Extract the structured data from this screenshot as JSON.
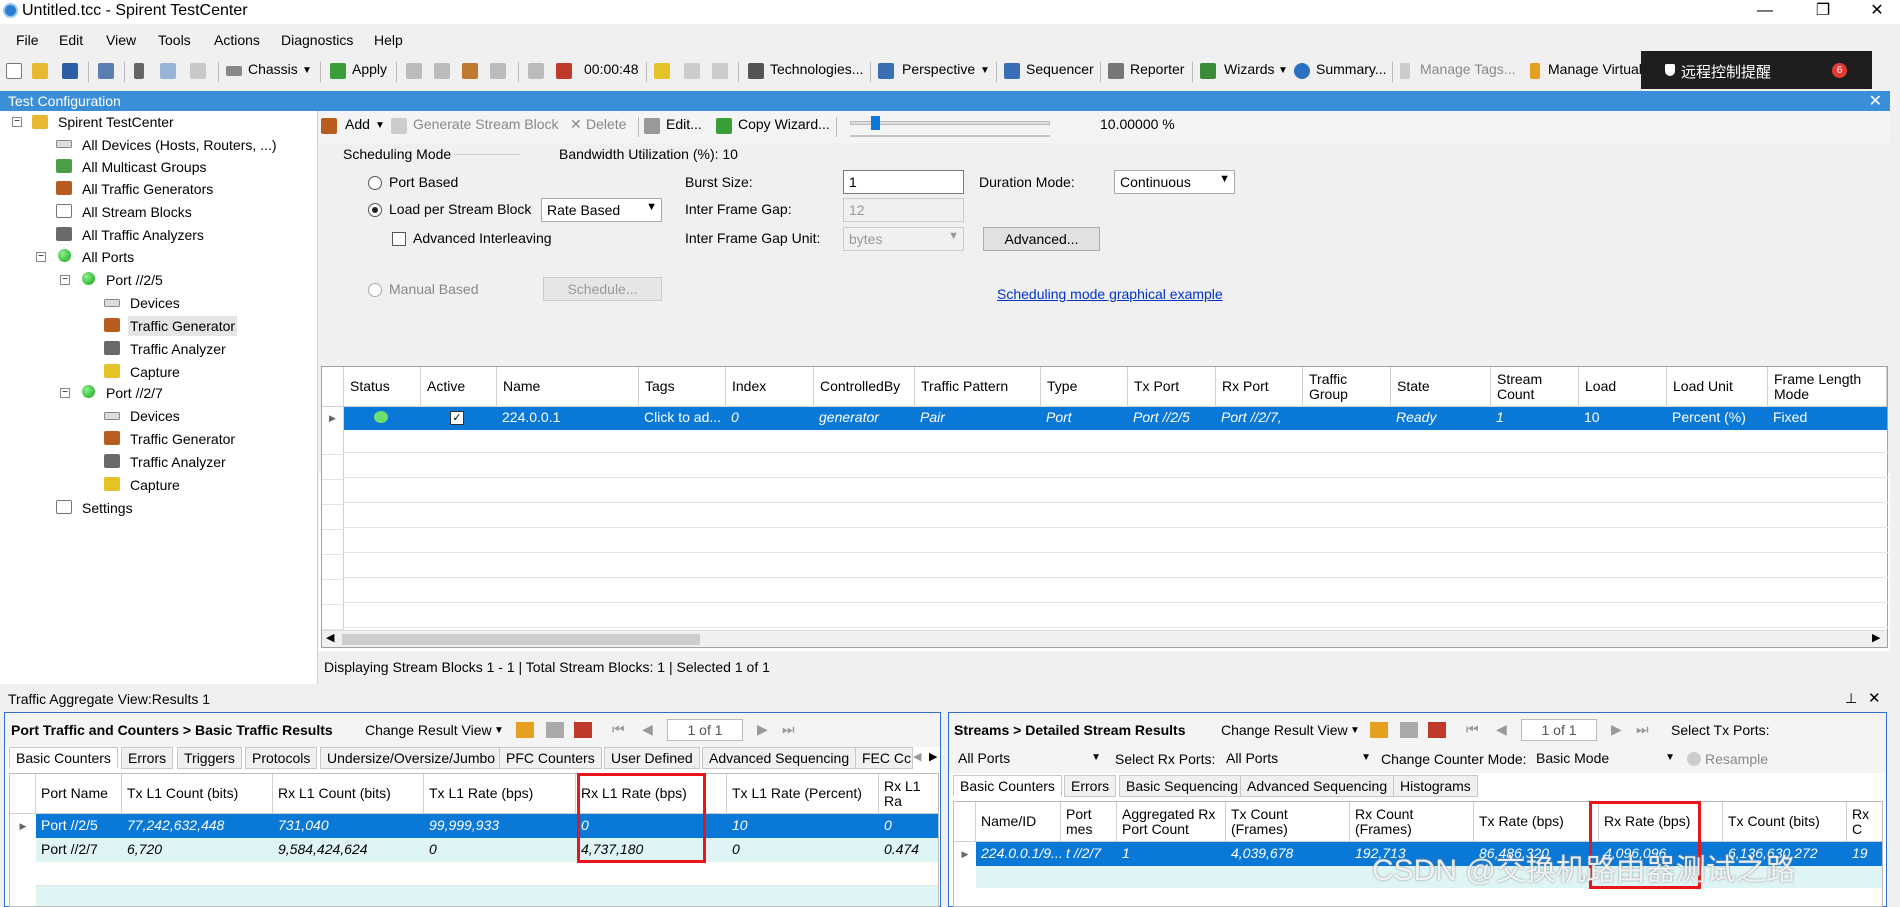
{
  "window": {
    "title": "Untitled.tcc - Spirent TestCenter",
    "min": "—",
    "max": "❐",
    "close": "✕"
  },
  "menu": [
    "File",
    "Edit",
    "View",
    "Tools",
    "Actions",
    "Diagnostics",
    "Help"
  ],
  "toolbar": {
    "chassis": "Chassis",
    "apply": "Apply",
    "timer": "00:00:48",
    "technologies": "Technologies...",
    "perspective": "Perspective",
    "sequencer": "Sequencer",
    "reporter": "Reporter",
    "wizards": "Wizards",
    "summary": "Summary...",
    "manage_tags": "Manage Tags...",
    "manage_virtual": "Manage Virtual"
  },
  "notification": {
    "text": "远程控制提醒",
    "count": "6"
  },
  "panel": {
    "title": "Test Configuration"
  },
  "tree": {
    "root": "Spirent TestCenter",
    "items": [
      "All Devices (Hosts, Routers, ...)",
      "All Multicast Groups",
      "All Traffic Generators",
      "All Stream Blocks",
      "All Traffic Analyzers",
      "All Ports"
    ],
    "port1": "Port //2/5",
    "port2": "Port //2/7",
    "children": [
      "Devices",
      "Traffic Generator",
      "Traffic Analyzer",
      "Capture"
    ],
    "settings": "Settings"
  },
  "subtoolbar": {
    "add": "Add",
    "generate": "Generate Stream Block",
    "delete": "Delete",
    "edit": "Edit...",
    "copy_wizard": "Copy Wizard...",
    "slider_value": "10.00000 %",
    "slider_fraction": 0.1
  },
  "form": {
    "scheduling_mode": "Scheduling Mode",
    "bandwidth": "Bandwidth Utilization (%): 10",
    "port_based": "Port Based",
    "load_per_stream": "Load per Stream Block",
    "rate_based": "Rate Based",
    "advanced_interleaving": "Advanced Interleaving",
    "manual_based": "Manual Based",
    "schedule_btn": "Schedule...",
    "burst_size_label": "Burst Size:",
    "burst_size": "1",
    "ifg_label": "Inter Frame Gap:",
    "ifg": "12",
    "ifg_unit_label": "Inter Frame Gap Unit:",
    "ifg_unit": "bytes",
    "duration_label": "Duration Mode:",
    "duration": "Continuous",
    "advanced_btn": "Advanced...",
    "graph_link": "Scheduling mode graphical example"
  },
  "grid": {
    "headers": [
      "Status",
      "Active",
      "Name",
      "Tags",
      "Index",
      "ControlledBy",
      "Traffic Pattern",
      "Type",
      "Tx Port",
      "Rx Port",
      "Traffic Group",
      "State",
      "Stream Count",
      "Load",
      "Load Unit",
      "Frame Length Mode"
    ],
    "row": {
      "name": "224.0.0.1",
      "tags": "Click to ad...",
      "index": "0",
      "controlled": "generator",
      "pattern": "Pair",
      "type": "Port",
      "tx": "Port //2/5",
      "rx": "Port //2/7,",
      "group": "",
      "state": "Ready",
      "count": "1",
      "load": "10",
      "unit": "Percent (%)",
      "flm": "Fixed"
    }
  },
  "status": "Displaying Stream Blocks 1 - 1  |  Total Stream Blocks: 1  |  Selected 1 of 1",
  "results": {
    "title": "Traffic Aggregate View:Results 1",
    "pin": "⊥",
    "close": "✕"
  },
  "left": {
    "title": "Port Traffic and Counters > Basic Traffic Results",
    "change": "Change Result View",
    "page": "1 of 1",
    "tabs": [
      "Basic Counters",
      "Errors",
      "Triggers",
      "Protocols",
      "Undersize/Oversize/Jumbo",
      "PFC Counters",
      "User Defined",
      "Advanced Sequencing",
      "FEC Cc"
    ],
    "headers": [
      "Port Name",
      "Tx L1 Count (bits)",
      "Rx L1 Count (bits)",
      "Tx L1 Rate (bps)",
      "Rx L1 Rate (bps)",
      "Tx L1 Rate (Percent)",
      "Rx L1 Ra"
    ],
    "rows": [
      [
        "Port //2/5",
        "77,242,632,448",
        "731,040",
        "99,999,933",
        "0",
        "10",
        "0"
      ],
      [
        "Port //2/7",
        "6,720",
        "9,584,424,624",
        "0",
        "4,737,180",
        "0",
        "0.474"
      ]
    ]
  },
  "right": {
    "title": "Streams > Detailed Stream Results",
    "change": "Change Result View",
    "page": "1 of 1",
    "select_tx": "Select Tx Ports:",
    "all_ports": "All Ports",
    "select_rx": "Select Rx Ports:",
    "rx_ports": "All Ports",
    "counter_mode": "Change Counter Mode:",
    "mode": "Basic Mode",
    "resample": "Resample",
    "tabs": [
      "Basic Counters",
      "Errors",
      "Basic Sequencing",
      "Advanced Sequencing",
      "Histograms"
    ],
    "headers": [
      "Name/ID",
      "Port mes",
      "Aggregated Rx Port Count",
      "Tx Count (Frames)",
      "Rx Count (Frames)",
      "Tx Rate (bps)",
      "Rx Rate (bps)",
      "Tx Count (bits)",
      "Rx C"
    ],
    "row": [
      "224.0.0.1/9...",
      "t //2/7",
      "1",
      "4,039,678",
      "192,713",
      "86,486,320",
      "4,096,096",
      "6,136,630,272",
      "19"
    ]
  },
  "watermark": "CSDN @交换机路由器测试之路",
  "colors": {
    "accent": "#0a78d7",
    "header": "#3b8fd8",
    "highlight": "#e8161b"
  }
}
